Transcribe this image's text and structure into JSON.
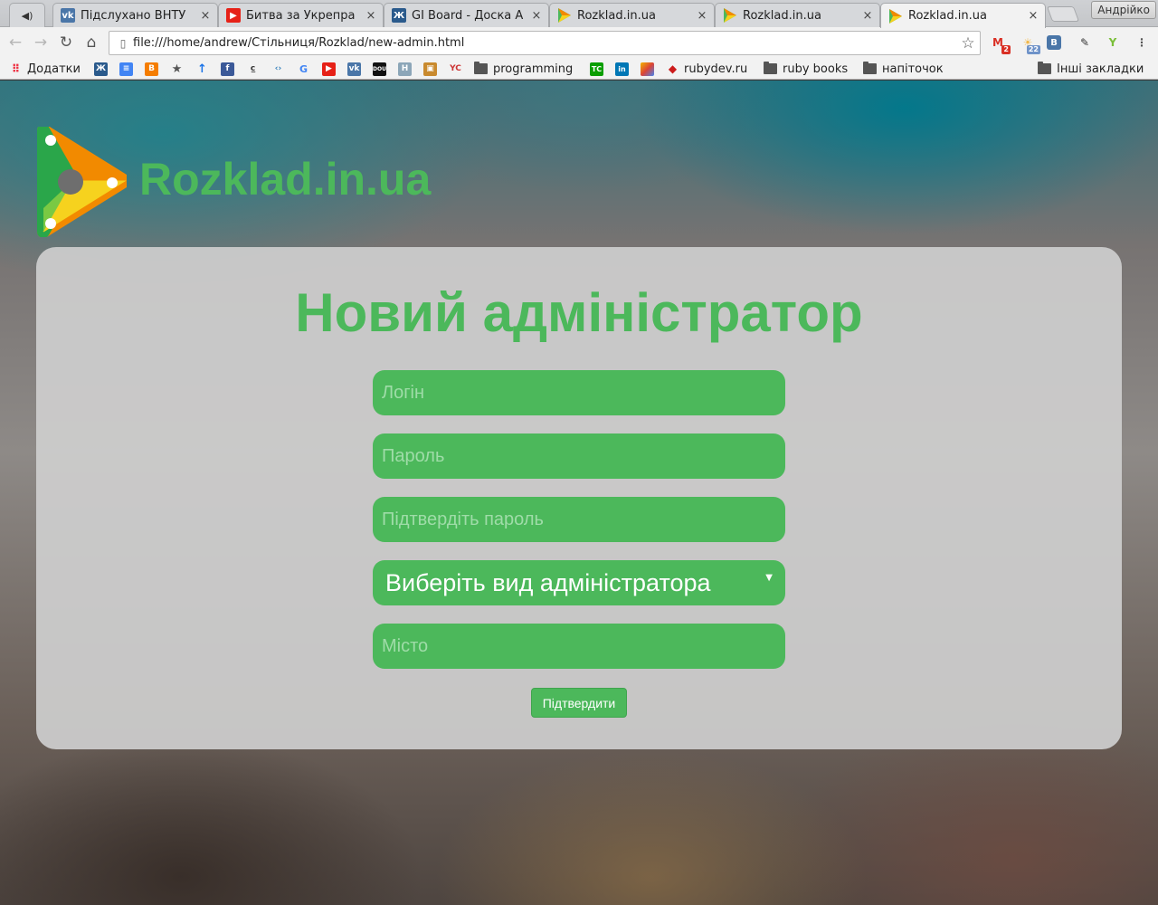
{
  "browser": {
    "tabs": [
      {
        "title": "Підслухано ВНТУ",
        "favicon": "vk-icon",
        "color": "#4a76a8"
      },
      {
        "title": "Битва за Укрепра",
        "favicon": "youtube-icon",
        "color": "#e62117"
      },
      {
        "title": "GI Board - Доска А",
        "favicon": "gi-icon",
        "color": "#2a5a8c"
      },
      {
        "title": "Rozklad.in.ua",
        "favicon": "rozklad-icon",
        "color": "#4cb85b"
      },
      {
        "title": "Rozklad.in.ua",
        "favicon": "rozklad-icon",
        "color": "#4cb85b"
      },
      {
        "title": "Rozklad.in.ua",
        "favicon": "rozklad-icon",
        "color": "#4cb85b"
      }
    ],
    "close_glyph": "×",
    "profile_name": "Андрійко",
    "url": "file:///home/andrew/Стільниця/Rozklad/new-admin.html",
    "extensions": [
      {
        "name": "gmail-icon",
        "badge": "2",
        "color": "#d93025"
      },
      {
        "name": "weather-icon",
        "badge": "22",
        "color": "#f2b84b"
      },
      {
        "name": "vk-icon",
        "badge": "",
        "color": "#4a76a8"
      },
      {
        "name": "eyedropper-icon",
        "badge": "",
        "color": "#333333"
      },
      {
        "name": "sprout-icon",
        "badge": "",
        "color": "#7bbf3a"
      }
    ],
    "bookmarks": {
      "apps_label": "Додатки",
      "programming": "programming",
      "rubydev": "rubydev.ru",
      "rubybooks": "ruby books",
      "napitochok": "напіточок",
      "other": "Інші закладки"
    }
  },
  "page": {
    "brand": "Rozklad.in.ua",
    "title": "Новий адміністратор",
    "fields": {
      "login_placeholder": "Логін",
      "password_placeholder": "Пароль",
      "confirm_placeholder": "Підтвердіть пароль",
      "admin_type_selected": "Виберіть вид адміністратора",
      "city_placeholder": "Місто"
    },
    "submit_label": "Підтвердити",
    "colors": {
      "accent": "#4cb85b",
      "logo_green": "#2aa64a",
      "logo_orange": "#f28a00",
      "logo_yellow": "#f6d21e"
    }
  }
}
